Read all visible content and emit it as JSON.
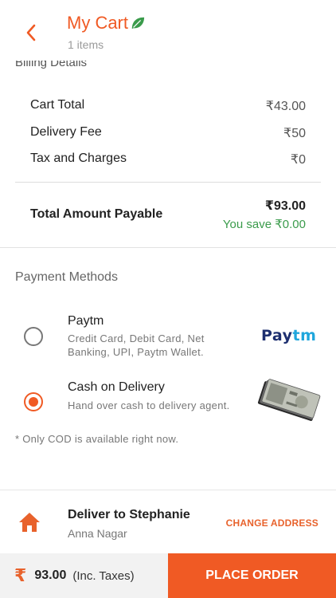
{
  "header": {
    "title": "My Cart",
    "subtitle": "1 items"
  },
  "billing": {
    "heading": "Billing Details",
    "rows": [
      {
        "label": "Cart Total",
        "value": "₹43.00"
      },
      {
        "label": "Delivery Fee",
        "value": "₹50"
      },
      {
        "label": "Tax and Charges",
        "value": "₹0"
      }
    ],
    "total_label": "Total Amount Payable",
    "total_value": "₹93.00",
    "savings": "You save ₹0.00"
  },
  "payment": {
    "heading": "Payment Methods",
    "options": [
      {
        "title": "Paytm",
        "description": "Credit Card, Debit Card, Net Banking, UPI, Paytm Wallet.",
        "selected": false,
        "logo_pay": "Pay",
        "logo_tm": "tm"
      },
      {
        "title": "Cash on Delivery",
        "description": "Hand over cash to delivery agent.",
        "selected": true
      }
    ],
    "note": "* Only COD is available right now."
  },
  "address": {
    "title": "Deliver to Stephanie",
    "subtitle": "Anna Nagar",
    "change_label": "CHANGE ADDRESS"
  },
  "footer": {
    "currency_symbol": "₹",
    "amount": "93.00",
    "tax_note": "(Inc. Taxes)",
    "place_order_label": "PLACE ORDER"
  },
  "colors": {
    "accent": "#f05a24",
    "savings_green": "#3a9b4b",
    "paytm_navy": "#1d2f6f",
    "paytm_blue": "#1fa6dc"
  },
  "icons": [
    "back-arrow-icon",
    "leaf-icon",
    "home-icon",
    "rupee-icon",
    "cash-notes-image"
  ]
}
